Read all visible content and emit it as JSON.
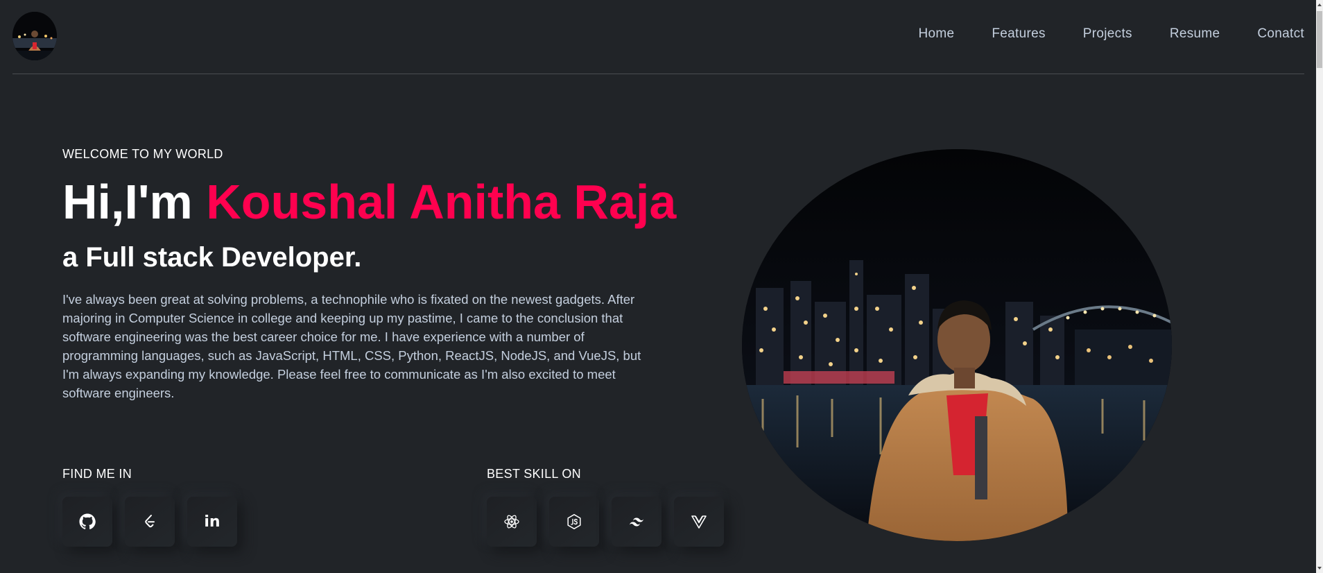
{
  "nav": {
    "logo_icon": "profile-avatar",
    "links": [
      "Home",
      "Features",
      "Projects",
      "Resume",
      "Conatct"
    ]
  },
  "hero": {
    "welcome": "WELCOME TO MY WORLD",
    "greeting": "Hi,I'm ",
    "name": "Koushal Anitha Raja",
    "role": "a Full stack Developer.",
    "bio": "I've always been great at solving problems, a technophile who is fixated on the newest gadgets. After majoring in Computer Science in college and keeping up my pastime, I came to the conclusion that software engineering was the best career choice for me. I have experience with a number of programming languages, such as JavaScript, HTML, CSS, Python, ReactJS, NodeJS, and VueJS, but I'm always expanding my knowledge. Please feel free to communicate as I'm also excited to meet software engineers."
  },
  "find_me": {
    "label": "FIND ME IN",
    "icons": [
      "github-icon",
      "leetcode-icon",
      "linkedin-icon"
    ],
    "linkedin_text": "in"
  },
  "best_skill": {
    "label": "BEST SKILL ON",
    "icons": [
      "react-icon",
      "nodejs-icon",
      "tailwind-icon",
      "vue-icon"
    ]
  },
  "colors": {
    "background": "#212428",
    "accent": "#ff014f",
    "text": "#c4cfde",
    "heading": "#ffffff"
  }
}
